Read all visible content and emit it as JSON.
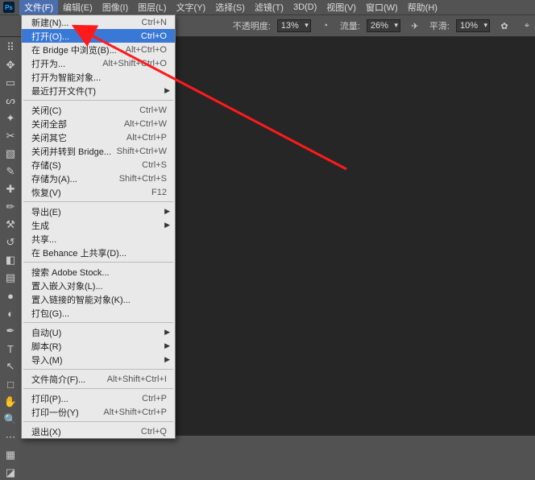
{
  "menubar": {
    "items": [
      {
        "label": "文件(F)",
        "open": true
      },
      {
        "label": "编辑(E)"
      },
      {
        "label": "图像(I)"
      },
      {
        "label": "图层(L)"
      },
      {
        "label": "文字(Y)"
      },
      {
        "label": "选择(S)"
      },
      {
        "label": "滤镜(T)"
      },
      {
        "label": "3D(D)"
      },
      {
        "label": "视图(V)"
      },
      {
        "label": "窗口(W)"
      },
      {
        "label": "帮助(H)"
      }
    ]
  },
  "optbar": {
    "opacity_label": "不透明度:",
    "opacity_value": "13%",
    "flow_label": "流量:",
    "flow_value": "26%",
    "smooth_label": "平滑:",
    "smooth_value": "10%"
  },
  "dropdown": {
    "groups": [
      [
        {
          "label": "新建(N)...",
          "shortcut": "Ctrl+N"
        },
        {
          "label": "打开(O)...",
          "shortcut": "Ctrl+O",
          "hl": true
        },
        {
          "label": "在 Bridge 中浏览(B)...",
          "shortcut": "Alt+Ctrl+O"
        },
        {
          "label": "打开为...",
          "shortcut": "Alt+Shift+Ctrl+O"
        },
        {
          "label": "打开为智能对象..."
        },
        {
          "label": "最近打开文件(T)",
          "sub": true
        }
      ],
      [
        {
          "label": "关闭(C)",
          "shortcut": "Ctrl+W"
        },
        {
          "label": "关闭全部",
          "shortcut": "Alt+Ctrl+W"
        },
        {
          "label": "关闭其它",
          "shortcut": "Alt+Ctrl+P"
        },
        {
          "label": "关闭并转到 Bridge...",
          "shortcut": "Shift+Ctrl+W"
        },
        {
          "label": "存储(S)",
          "shortcut": "Ctrl+S"
        },
        {
          "label": "存储为(A)...",
          "shortcut": "Shift+Ctrl+S"
        },
        {
          "label": "恢复(V)",
          "shortcut": "F12"
        }
      ],
      [
        {
          "label": "导出(E)",
          "sub": true
        },
        {
          "label": "生成",
          "sub": true
        },
        {
          "label": "共享..."
        },
        {
          "label": "在 Behance 上共享(D)..."
        }
      ],
      [
        {
          "label": "搜索 Adobe Stock..."
        },
        {
          "label": "置入嵌入对象(L)..."
        },
        {
          "label": "置入链接的智能对象(K)..."
        },
        {
          "label": "打包(G)..."
        }
      ],
      [
        {
          "label": "自动(U)",
          "sub": true
        },
        {
          "label": "脚本(R)",
          "sub": true
        },
        {
          "label": "导入(M)",
          "sub": true
        }
      ],
      [
        {
          "label": "文件简介(F)...",
          "shortcut": "Alt+Shift+Ctrl+I"
        }
      ],
      [
        {
          "label": "打印(P)...",
          "shortcut": "Ctrl+P"
        },
        {
          "label": "打印一份(Y)",
          "shortcut": "Alt+Shift+Ctrl+P"
        }
      ],
      [
        {
          "label": "退出(X)",
          "shortcut": "Ctrl+Q"
        }
      ]
    ]
  },
  "tools": [
    {
      "name": "grip-icon",
      "g": "⠿"
    },
    {
      "name": "move-icon",
      "g": "✥"
    },
    {
      "name": "marquee-icon",
      "g": "▭"
    },
    {
      "name": "lasso-icon",
      "g": "ᔕ"
    },
    {
      "name": "quick-select-icon",
      "g": "✦"
    },
    {
      "name": "crop-icon",
      "g": "✂"
    },
    {
      "name": "frame-icon",
      "g": "▧"
    },
    {
      "name": "eyedropper-icon",
      "g": "✎"
    },
    {
      "name": "spot-heal-icon",
      "g": "✚"
    },
    {
      "name": "brush-icon",
      "g": "✏"
    },
    {
      "name": "clone-stamp-icon",
      "g": "⚒"
    },
    {
      "name": "history-brush-icon",
      "g": "↺"
    },
    {
      "name": "eraser-icon",
      "g": "◧"
    },
    {
      "name": "gradient-icon",
      "g": "▤"
    },
    {
      "name": "blur-icon",
      "g": "●"
    },
    {
      "name": "dodge-icon",
      "g": "◐"
    },
    {
      "name": "pen-icon",
      "g": "✒"
    },
    {
      "name": "type-icon",
      "g": "T"
    },
    {
      "name": "path-select-icon",
      "g": "↖"
    },
    {
      "name": "rectangle-icon",
      "g": "□"
    },
    {
      "name": "hand-icon",
      "g": "✋"
    },
    {
      "name": "zoom-icon",
      "g": "🔍"
    },
    {
      "name": "more-icon",
      "g": "⋯"
    },
    {
      "name": "edit-toolbar-icon",
      "g": "▦"
    },
    {
      "name": "colors-icon",
      "g": "◪"
    }
  ]
}
